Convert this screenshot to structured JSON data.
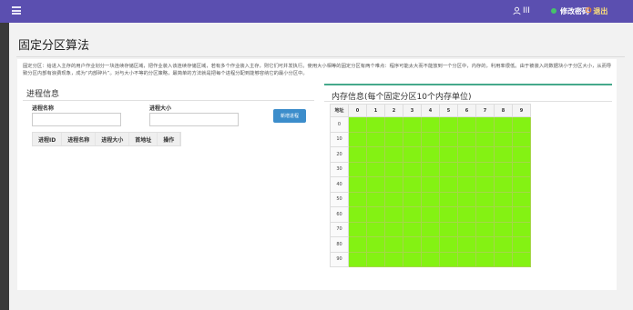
{
  "header": {
    "user_name": "III",
    "change_password_label": "修改密码",
    "logout_label": "退出",
    "colors": {
      "bar": "#5b4fb0",
      "logout_text": "#ffe27a",
      "status_dot": "#46c36a"
    }
  },
  "page": {
    "title": "固定分区算法",
    "description": "固定分区：给进入主存的用户作业划分一块连续存储区域，把作业装入该连续存储区域，若有多个作业装入主存，则它们可并发执行。使用大小相等的固定分区有两个难点：程序可能太大而不能放到一个分区中，内存的，利用率很低。由于被装入的数据块小于分区大小，从而导致分区内部有浪费现象，成为“内部碎片”。对与大小不等的分区策略，最简单的方法就是把每个进程分配到能够容纳它的最小分区中。"
  },
  "process_panel": {
    "title": "进程信息",
    "name_label": "进程名称",
    "size_label": "进程大小",
    "name_value": "",
    "size_value": "",
    "add_button_label": "新增进程",
    "table_headers": [
      "进程ID",
      "进程名称",
      "进程大小",
      "首地址",
      "操作"
    ],
    "rows": []
  },
  "memory_panel": {
    "title": "内存信息(每个固定分区10个内存单位)",
    "address_header": "地址",
    "columns": [
      "0",
      "1",
      "2",
      "3",
      "4",
      "5",
      "6",
      "7",
      "8",
      "9"
    ],
    "addresses": [
      "0",
      "10",
      "20",
      "30",
      "40",
      "50",
      "60",
      "70",
      "80",
      "90"
    ],
    "cell_color_free": "#84f213",
    "accent_rule_color": "#45a98b"
  }
}
